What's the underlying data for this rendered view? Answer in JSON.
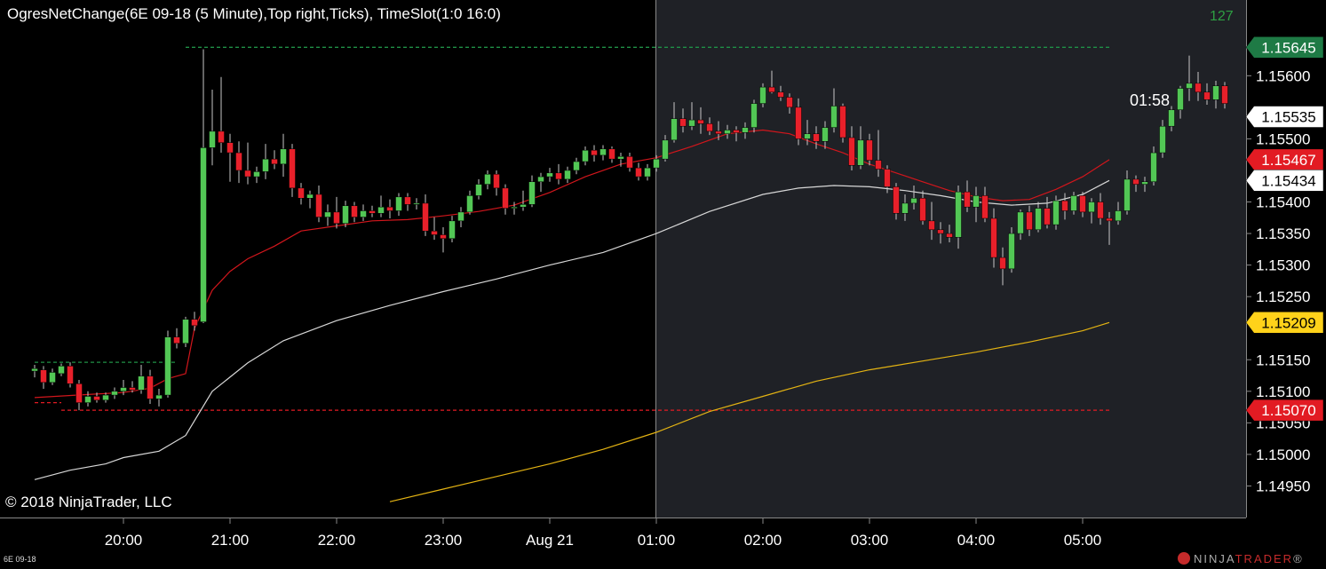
{
  "header": {
    "title": "OgresNetChange(6E 09-18 (5 Minute),Top right,Ticks), TimeSlot(1:0    16:0)",
    "counter": "127",
    "bar_timer": "01:58",
    "copyright": "© 2018 NinjaTrader, LLC",
    "instrument": "6E 09-18",
    "brand_prefix": "NINJA",
    "brand_suffix": "TRADER",
    "brand_mark": "®"
  },
  "colors": {
    "background": "#000000",
    "session_background": "#1f2126",
    "up_candle": "#52c755",
    "down_candle": "#e8202a",
    "ema_fast": "#d2161c",
    "sma_mid": "#d7d7d7",
    "sma_slow": "#e3b313",
    "net_change": "#1f9046",
    "label_green": "#1e7a45",
    "label_red": "#e21b23",
    "label_yellow": "#ffd21a",
    "label_white": "#ffffff",
    "axis_text": "#ffffff"
  },
  "chart_data": {
    "type": "candlestick",
    "x_axis_labels": [
      "20:00",
      "21:00",
      "22:00",
      "23:00",
      "Aug 21",
      "01:00",
      "02:00",
      "03:00",
      "04:00",
      "05:00"
    ],
    "y_axis": {
      "min": 1.149,
      "max": 1.1572,
      "ticks": [
        "1.14950",
        "1.15000",
        "1.15050",
        "1.15100",
        "1.15150",
        "1.15250",
        "1.15300",
        "1.15350",
        "1.15400",
        "1.15500",
        "1.15600"
      ],
      "grid": false
    },
    "session_start": "01:00",
    "ohlc_start": "19:10",
    "bar_minutes": 5,
    "candles": [
      [
        1.15132,
        1.15142,
        1.15122,
        1.15136
      ],
      [
        1.15134,
        1.1514,
        1.15104,
        1.15114
      ],
      [
        1.15114,
        1.15136,
        1.1511,
        1.1513
      ],
      [
        1.15128,
        1.15144,
        1.15124,
        1.1514
      ],
      [
        1.1514,
        1.15146,
        1.15106,
        1.15112
      ],
      [
        1.15112,
        1.15118,
        1.1507,
        1.15082
      ],
      [
        1.15082,
        1.151,
        1.15076,
        1.15092
      ],
      [
        1.15092,
        1.15098,
        1.15082,
        1.15086
      ],
      [
        1.15086,
        1.15098,
        1.15082,
        1.15094
      ],
      [
        1.15094,
        1.15106,
        1.15088,
        1.151
      ],
      [
        1.151,
        1.15118,
        1.15094,
        1.15106
      ],
      [
        1.15106,
        1.15116,
        1.15098,
        1.15102
      ],
      [
        1.15102,
        1.15142,
        1.15096,
        1.15124
      ],
      [
        1.15124,
        1.15134,
        1.1508,
        1.15088
      ],
      [
        1.15088,
        1.15104,
        1.15076,
        1.15094
      ],
      [
        1.15094,
        1.15196,
        1.1509,
        1.15186
      ],
      [
        1.15186,
        1.152,
        1.15168,
        1.15176
      ],
      [
        1.15176,
        1.15218,
        1.1517,
        1.15214
      ],
      [
        1.15214,
        1.15226,
        1.15196,
        1.15204
      ],
      [
        1.1521,
        1.15642,
        1.15208,
        1.15486
      ],
      [
        1.15486,
        1.15578,
        1.15458,
        1.15512
      ],
      [
        1.15512,
        1.15598,
        1.15478,
        1.15494
      ],
      [
        1.15494,
        1.15508,
        1.15432,
        1.15478
      ],
      [
        1.15478,
        1.15496,
        1.1543,
        1.1545
      ],
      [
        1.1545,
        1.15494,
        1.15428,
        1.1544
      ],
      [
        1.1544,
        1.15456,
        1.1543,
        1.15448
      ],
      [
        1.15448,
        1.15492,
        1.15436,
        1.15468
      ],
      [
        1.15468,
        1.15482,
        1.15452,
        1.1546
      ],
      [
        1.1546,
        1.15508,
        1.1544,
        1.15484
      ],
      [
        1.15484,
        1.15492,
        1.15408,
        1.15422
      ],
      [
        1.15422,
        1.1543,
        1.15396,
        1.15406
      ],
      [
        1.15406,
        1.15418,
        1.1539,
        1.15412
      ],
      [
        1.15412,
        1.15426,
        1.15368,
        1.15376
      ],
      [
        1.15376,
        1.15396,
        1.15362,
        1.15384
      ],
      [
        1.15384,
        1.15408,
        1.15358,
        1.15366
      ],
      [
        1.15366,
        1.15402,
        1.1536,
        1.15394
      ],
      [
        1.15394,
        1.154,
        1.15368,
        1.15376
      ],
      [
        1.15376,
        1.15396,
        1.1537,
        1.15386
      ],
      [
        1.15386,
        1.15394,
        1.15376,
        1.15382
      ],
      [
        1.15382,
        1.1541,
        1.15376,
        1.15392
      ],
      [
        1.15392,
        1.15404,
        1.15374,
        1.15386
      ],
      [
        1.15386,
        1.15414,
        1.15378,
        1.15408
      ],
      [
        1.15408,
        1.15414,
        1.15386,
        1.15396
      ],
      [
        1.15396,
        1.15406,
        1.15388,
        1.15398
      ],
      [
        1.15398,
        1.15412,
        1.15346,
        1.15354
      ],
      [
        1.15354,
        1.15376,
        1.1534,
        1.15348
      ],
      [
        1.15348,
        1.1536,
        1.1532,
        1.15342
      ],
      [
        1.15342,
        1.15378,
        1.15336,
        1.1537
      ],
      [
        1.1537,
        1.15392,
        1.1536,
        1.15384
      ],
      [
        1.15384,
        1.15418,
        1.1538,
        1.1541
      ],
      [
        1.1541,
        1.15436,
        1.15404,
        1.15428
      ],
      [
        1.15428,
        1.1545,
        1.1542,
        1.15444
      ],
      [
        1.15444,
        1.1545,
        1.1541,
        1.15422
      ],
      [
        1.15422,
        1.15428,
        1.1538,
        1.1539
      ],
      [
        1.1539,
        1.154,
        1.1538,
        1.15392
      ],
      [
        1.15392,
        1.15418,
        1.15386,
        1.15396
      ],
      [
        1.15396,
        1.15442,
        1.15392,
        1.15432
      ],
      [
        1.15432,
        1.15446,
        1.15416,
        1.1544
      ],
      [
        1.1544,
        1.15454,
        1.15432,
        1.15446
      ],
      [
        1.15446,
        1.1546,
        1.15428,
        1.15436
      ],
      [
        1.15436,
        1.15456,
        1.1543,
        1.1545
      ],
      [
        1.1545,
        1.1547,
        1.15444,
        1.15464
      ],
      [
        1.15464,
        1.15488,
        1.15458,
        1.15482
      ],
      [
        1.15482,
        1.1549,
        1.15464,
        1.15474
      ],
      [
        1.15474,
        1.1549,
        1.15466,
        1.15484
      ],
      [
        1.15484,
        1.15488,
        1.15462,
        1.15468
      ],
      [
        1.15468,
        1.15478,
        1.15456,
        1.15472
      ],
      [
        1.15472,
        1.15478,
        1.15448,
        1.15454
      ],
      [
        1.15454,
        1.15462,
        1.15434,
        1.1544
      ],
      [
        1.1544,
        1.1546,
        1.15434,
        1.15454
      ],
      [
        1.15454,
        1.15474,
        1.15448,
        1.15468
      ],
      [
        1.15468,
        1.15506,
        1.15464,
        1.15498
      ],
      [
        1.15498,
        1.15558,
        1.15494,
        1.15532
      ],
      [
        1.15532,
        1.15548,
        1.1551,
        1.1552
      ],
      [
        1.1552,
        1.15558,
        1.15514,
        1.1553
      ],
      [
        1.1553,
        1.1555,
        1.15508,
        1.15524
      ],
      [
        1.15524,
        1.15534,
        1.15506,
        1.15512
      ],
      [
        1.15512,
        1.15528,
        1.15498,
        1.15508
      ],
      [
        1.15508,
        1.15522,
        1.155,
        1.15514
      ],
      [
        1.15514,
        1.1552,
        1.15496,
        1.1551
      ],
      [
        1.1551,
        1.15526,
        1.155,
        1.15518
      ],
      [
        1.15518,
        1.15562,
        1.1551,
        1.15556
      ],
      [
        1.15556,
        1.15588,
        1.1555,
        1.15582
      ],
      [
        1.15582,
        1.15608,
        1.15572,
        1.15574
      ],
      [
        1.15574,
        1.15584,
        1.1556,
        1.15566
      ],
      [
        1.15566,
        1.15572,
        1.1554,
        1.1555
      ],
      [
        1.1555,
        1.15564,
        1.1549,
        1.155
      ],
      [
        1.155,
        1.1553,
        1.1549,
        1.15508
      ],
      [
        1.15508,
        1.1552,
        1.15484,
        1.15496
      ],
      [
        1.15496,
        1.15528,
        1.15484,
        1.15518
      ],
      [
        1.15518,
        1.1558,
        1.1551,
        1.15552
      ],
      [
        1.15552,
        1.15556,
        1.15494,
        1.15502
      ],
      [
        1.15502,
        1.1552,
        1.1545,
        1.15458
      ],
      [
        1.15458,
        1.1552,
        1.15452,
        1.15498
      ],
      [
        1.15498,
        1.15508,
        1.15458,
        1.15466
      ],
      [
        1.15466,
        1.15514,
        1.1544,
        1.15452
      ],
      [
        1.15452,
        1.15458,
        1.15414,
        1.15424
      ],
      [
        1.15424,
        1.1543,
        1.15372,
        1.15382
      ],
      [
        1.15382,
        1.15412,
        1.1537,
        1.15398
      ],
      [
        1.15398,
        1.15426,
        1.15388,
        1.15406
      ],
      [
        1.15406,
        1.15418,
        1.15364,
        1.1537
      ],
      [
        1.1537,
        1.154,
        1.1534,
        1.15356
      ],
      [
        1.15356,
        1.15368,
        1.15334,
        1.1535
      ],
      [
        1.1535,
        1.15364,
        1.15336,
        1.15344
      ],
      [
        1.15344,
        1.15426,
        1.15326,
        1.15416
      ],
      [
        1.15416,
        1.15434,
        1.15384,
        1.15392
      ],
      [
        1.15392,
        1.15424,
        1.15368,
        1.1541
      ],
      [
        1.1541,
        1.15424,
        1.15368,
        1.15374
      ],
      [
        1.15374,
        1.1539,
        1.15296,
        1.15312
      ],
      [
        1.15312,
        1.15328,
        1.15268,
        1.15294
      ],
      [
        1.15294,
        1.1536,
        1.15288,
        1.1535
      ],
      [
        1.1535,
        1.15388,
        1.1534,
        1.15384
      ],
      [
        1.15384,
        1.15394,
        1.15346,
        1.15356
      ],
      [
        1.15356,
        1.154,
        1.15352,
        1.1539
      ],
      [
        1.1539,
        1.15408,
        1.15358,
        1.15364
      ],
      [
        1.15364,
        1.1541,
        1.15356,
        1.15402
      ],
      [
        1.15402,
        1.15414,
        1.15372,
        1.15386
      ],
      [
        1.15386,
        1.15416,
        1.1538,
        1.1541
      ],
      [
        1.1541,
        1.15416,
        1.15376,
        1.15384
      ],
      [
        1.15384,
        1.15406,
        1.15366,
        1.154
      ],
      [
        1.154,
        1.15414,
        1.15364,
        1.15374
      ],
      [
        1.15374,
        1.15384,
        1.15332,
        1.1537
      ],
      [
        1.1537,
        1.154,
        1.15364,
        1.15386
      ],
      [
        1.15386,
        1.1545,
        1.1538,
        1.15436
      ],
      [
        1.15436,
        1.15442,
        1.15416,
        1.15428
      ],
      [
        1.15428,
        1.1544,
        1.15416,
        1.15432
      ],
      [
        1.15432,
        1.15488,
        1.15426,
        1.15478
      ],
      [
        1.15478,
        1.1553,
        1.1547,
        1.1552
      ],
      [
        1.1552,
        1.15552,
        1.15512,
        1.15546
      ],
      [
        1.15546,
        1.15584,
        1.15532,
        1.1558
      ],
      [
        1.1558,
        1.15632,
        1.1556,
        1.15588
      ],
      [
        1.15588,
        1.15606,
        1.1556,
        1.15574
      ],
      [
        1.15574,
        1.15588,
        1.15554,
        1.15562
      ],
      [
        1.15562,
        1.15592,
        1.15548,
        1.15584
      ],
      [
        1.15584,
        1.1559,
        1.15548,
        1.15556
      ]
    ],
    "series": [
      {
        "color": "#d2161c",
        "width": 1.2,
        "points": [
          [
            "19:10",
            1.1509
          ],
          [
            "19:40",
            1.15095
          ],
          [
            "20:00",
            1.15098
          ],
          [
            "20:15",
            1.15105
          ],
          [
            "20:25",
            1.1512
          ],
          [
            "20:35",
            1.15128
          ],
          [
            "20:40",
            1.152
          ],
          [
            "20:50",
            1.1526
          ],
          [
            "21:00",
            1.1529
          ],
          [
            "21:10",
            1.1531
          ],
          [
            "21:25",
            1.1533
          ],
          [
            "21:40",
            1.15354
          ],
          [
            "22:00",
            1.15362
          ],
          [
            "22:20",
            1.1537
          ],
          [
            "22:40",
            1.15372
          ],
          [
            "23:00",
            1.15378
          ],
          [
            "23:20",
            1.15385
          ],
          [
            "23:40",
            1.15395
          ],
          [
            "00:00",
            1.15415
          ],
          [
            "00:20",
            1.1544
          ],
          [
            "00:40",
            1.1546
          ],
          [
            "01:00",
            1.1547
          ],
          [
            "01:20",
            1.15488
          ],
          [
            "01:40",
            1.15508
          ],
          [
            "02:00",
            1.15514
          ],
          [
            "02:15",
            1.15508
          ],
          [
            "02:30",
            1.15492
          ],
          [
            "02:45",
            1.15478
          ],
          [
            "03:00",
            1.1546
          ],
          [
            "03:15",
            1.15446
          ],
          [
            "03:30",
            1.15432
          ],
          [
            "03:45",
            1.15418
          ],
          [
            "04:00",
            1.15408
          ],
          [
            "04:15",
            1.15402
          ],
          [
            "04:30",
            1.15404
          ],
          [
            "04:45",
            1.1542
          ],
          [
            "05:00",
            1.1544
          ],
          [
            "05:10",
            1.15458
          ],
          [
            "05:15",
            1.15467
          ]
        ]
      },
      {
        "color": "#d7d7d7",
        "width": 1.2,
        "points": [
          [
            "19:10",
            1.1496
          ],
          [
            "19:30",
            1.14975
          ],
          [
            "19:50",
            1.14985
          ],
          [
            "20:00",
            1.14995
          ],
          [
            "20:20",
            1.15005
          ],
          [
            "20:35",
            1.1503
          ],
          [
            "20:50",
            1.151
          ],
          [
            "21:10",
            1.15145
          ],
          [
            "21:30",
            1.1518
          ],
          [
            "22:00",
            1.15212
          ],
          [
            "22:30",
            1.15236
          ],
          [
            "23:00",
            1.15258
          ],
          [
            "23:30",
            1.15278
          ],
          [
            "00:00",
            1.153
          ],
          [
            "00:30",
            1.1532
          ],
          [
            "01:00",
            1.1535
          ],
          [
            "01:30",
            1.15385
          ],
          [
            "02:00",
            1.15412
          ],
          [
            "02:20",
            1.15422
          ],
          [
            "02:40",
            1.15426
          ],
          [
            "03:00",
            1.15424
          ],
          [
            "03:20",
            1.15418
          ],
          [
            "03:40",
            1.1541
          ],
          [
            "04:00",
            1.154
          ],
          [
            "04:20",
            1.15395
          ],
          [
            "04:40",
            1.15398
          ],
          [
            "05:00",
            1.15412
          ],
          [
            "05:15",
            1.15434
          ]
        ]
      },
      {
        "color": "#e3b313",
        "width": 1.2,
        "points": [
          [
            "22:30",
            1.14925
          ],
          [
            "23:00",
            1.14945
          ],
          [
            "23:30",
            1.14965
          ],
          [
            "00:00",
            1.14985
          ],
          [
            "00:30",
            1.15008
          ],
          [
            "01:00",
            1.15035
          ],
          [
            "01:30",
            1.15068
          ],
          [
            "02:00",
            1.15092
          ],
          [
            "02:30",
            1.15116
          ],
          [
            "03:00",
            1.15134
          ],
          [
            "03:30",
            1.15148
          ],
          [
            "04:00",
            1.15162
          ],
          [
            "04:30",
            1.15178
          ],
          [
            "05:00",
            1.15196
          ],
          [
            "05:15",
            1.15209
          ]
        ]
      }
    ],
    "reference_lines": [
      {
        "from": "20:35",
        "to": "05:15",
        "value": 1.15645,
        "color": "#1f9046"
      },
      {
        "from": "19:10",
        "to": "20:30",
        "value": 1.15146,
        "color": "#1f9046"
      },
      {
        "from": "19:10",
        "to": "19:25",
        "value": 1.15082,
        "color": "#e21b23"
      },
      {
        "from": "19:25",
        "to": "05:15",
        "value": 1.1507,
        "color": "#e21b23"
      }
    ],
    "price_labels": [
      {
        "text": "1.15645",
        "value": 1.15645,
        "bg": "#1e7a45",
        "fg": "#ffffff"
      },
      {
        "text": "1.15535",
        "value": 1.15535,
        "bg": "#ffffff",
        "fg": "#000000"
      },
      {
        "text": "1.15467",
        "value": 1.15467,
        "bg": "#e21b23",
        "fg": "#ffffff"
      },
      {
        "text": "1.15434",
        "value": 1.15434,
        "bg": "#ffffff",
        "fg": "#000000"
      },
      {
        "text": "1.15209",
        "value": 1.15209,
        "bg": "#ffd21a",
        "fg": "#000000"
      },
      {
        "text": "1.15070",
        "value": 1.1507,
        "bg": "#e21b23",
        "fg": "#ffffff"
      }
    ]
  }
}
